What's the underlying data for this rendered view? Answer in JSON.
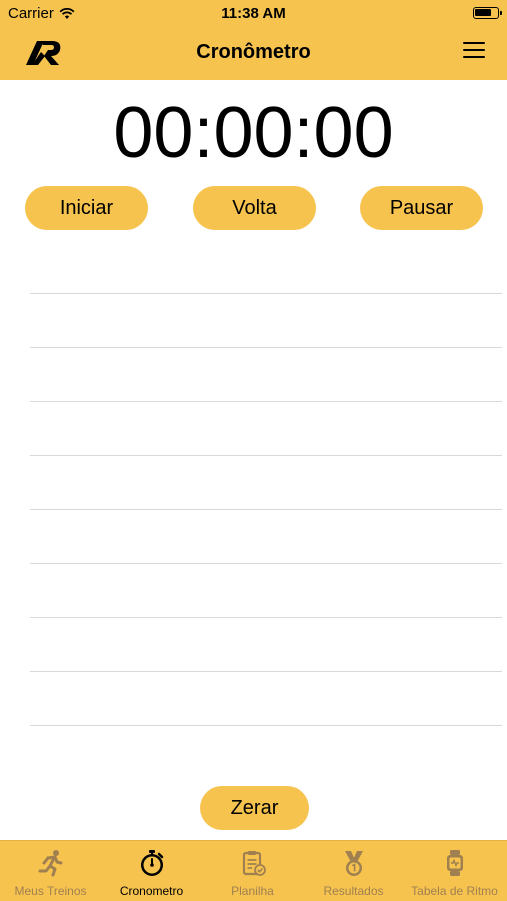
{
  "status_bar": {
    "carrier": "Carrier",
    "time": "11:38 AM"
  },
  "header": {
    "title": "Cronômetro",
    "icons": [
      "app-logo",
      "hamburger-menu-icon"
    ]
  },
  "stopwatch": {
    "display": "00:00:00"
  },
  "controls": {
    "start_label": "Iniciar",
    "lap_label": "Volta",
    "pause_label": "Pausar",
    "reset_label": "Zerar"
  },
  "tabbar": {
    "items": [
      {
        "label": "Meus Treinos",
        "icon": "runner-icon",
        "active": false
      },
      {
        "label": "Cronometro",
        "icon": "stopwatch-icon",
        "active": true
      },
      {
        "label": "Planilha",
        "icon": "clipboard-icon",
        "active": false
      },
      {
        "label": "Resultados",
        "icon": "medal-icon",
        "active": false
      },
      {
        "label": "Tabela de Ritmo",
        "icon": "smartwatch-icon",
        "active": false
      }
    ]
  },
  "colors": {
    "accent": "#F6C34F",
    "inactive_tab": "#a08050",
    "divider": "#d9d9d9"
  }
}
